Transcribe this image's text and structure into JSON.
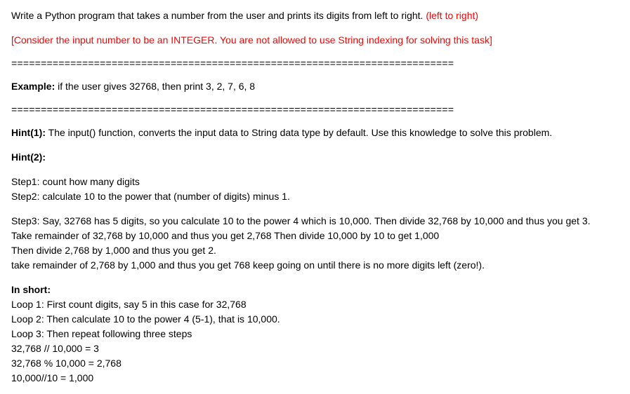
{
  "intro": {
    "task_prefix": "Write a Python program that takes a number from the user and prints its digits from left to right. ",
    "task_red": "(left to right)",
    "constraint": "[Consider the input number to be an INTEGER. You are not allowed to use String indexing for solving this task]"
  },
  "divider": "===========================================================================",
  "example": {
    "label": "Example:",
    "text": " if the user gives 32768, then print 3, 2, 7, 6, 8"
  },
  "hint1": {
    "label": "Hint(1):",
    "text": " The input() function, converts the input data to String data type by default. Use this knowledge to solve this problem."
  },
  "hint2": {
    "label": "Hint(2):",
    "steps12": [
      "Step1: count how many digits",
      "Step2: calculate 10 to the power that (number of digits) minus 1."
    ],
    "steps3": [
      "Step3: Say, 32768 has 5 digits, so you calculate 10 to the power 4 which is 10,000. Then divide 32,768 by 10,000 and thus you get 3.",
      "Take remainder of 32,768 by 10,000 and thus you get 2,768 Then divide 10,000 by 10 to get 1,000",
      "Then divide 2,768 by 1,000 and thus you get 2.",
      "take remainder of 2,768 by 1,000 and thus you get 768 keep going on until there is no more digits left (zero!)."
    ]
  },
  "inshort": {
    "label": "In short:",
    "lines": [
      "Loop 1: First count digits, say 5 in this case for 32,768",
      "Loop 2: Then calculate 10 to the power 4 (5-1), that is 10,000.",
      "Loop 3: Then repeat following three steps",
      "32,768 // 10,000 = 3",
      "32,768 % 10,000 = 2,768",
      "10,000//10 = 1,000"
    ]
  }
}
